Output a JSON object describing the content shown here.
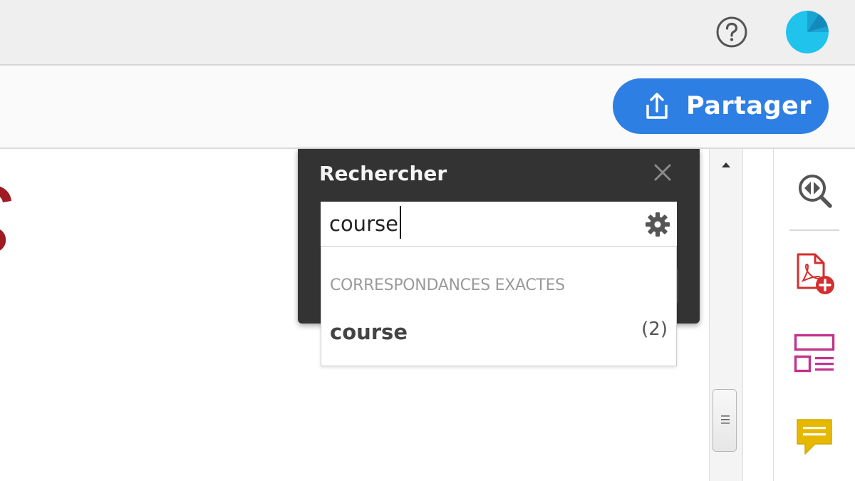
{
  "header": {
    "help_icon": "help-circle-icon",
    "avatar_color": "#1fc3ec"
  },
  "toolbar": {
    "share_label": "Partager",
    "share_icon": "share-upload-icon",
    "share_color": "#2d7fe3"
  },
  "search": {
    "title": "Rechercher",
    "query": "course",
    "close_icon": "close-icon",
    "settings_icon": "gear-icon",
    "dropdown": {
      "section_header": "CORRESPONDANCES EXACTES",
      "results": [
        {
          "term": "course",
          "count": "(2)"
        }
      ]
    }
  },
  "right_rail": {
    "tools": [
      {
        "icon": "zoom-compare-icon"
      },
      {
        "icon": "create-pdf-icon",
        "color": "#d32f2f"
      },
      {
        "icon": "organize-pages-icon",
        "color": "#c2338c"
      },
      {
        "icon": "comment-icon",
        "color": "#e6b800"
      }
    ]
  },
  "document": {
    "accent_color": "#9e1b24"
  }
}
